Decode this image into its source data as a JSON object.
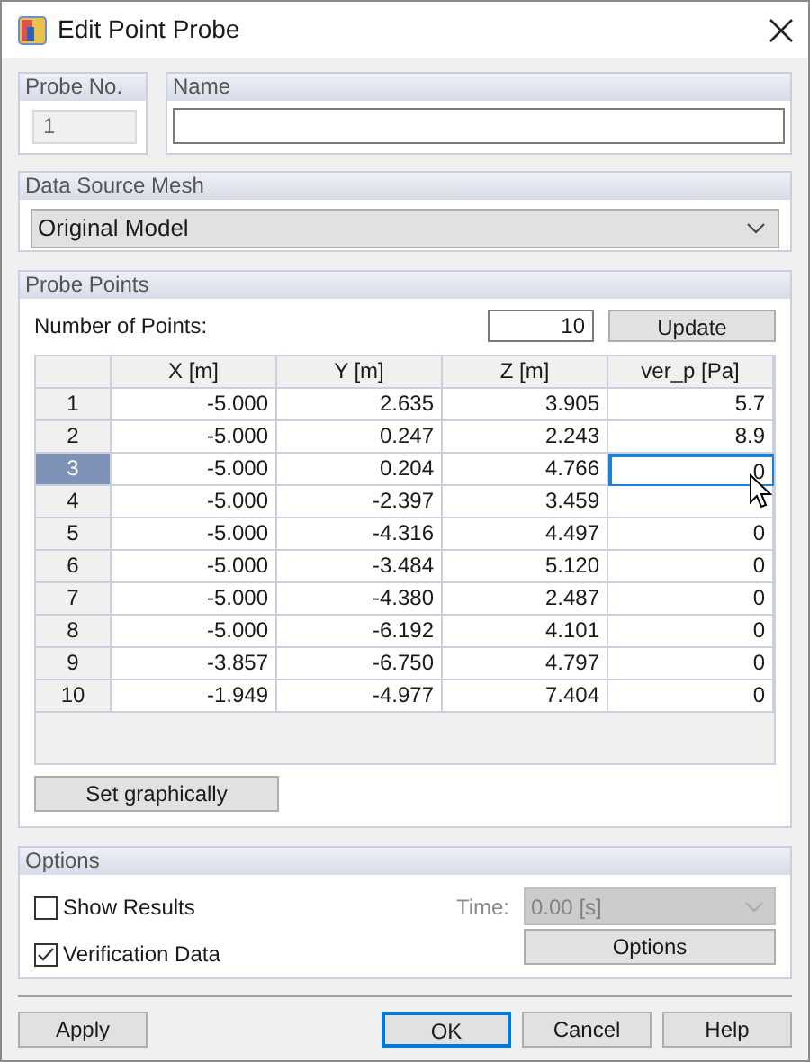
{
  "window": {
    "title": "Edit Point Probe"
  },
  "probe_no": {
    "label": "Probe No.",
    "value": "1",
    "disabled": true
  },
  "name": {
    "label": "Name"
  },
  "data_source_mesh": {
    "label": "Data Source Mesh",
    "value": "Original Model"
  },
  "probe_points": {
    "label": "Probe Points",
    "count_label": "Number of Points:",
    "count_value": "10",
    "update_button": "Update",
    "columns": [
      "X [m]",
      "Y [m]",
      "Z [m]",
      "ver_p [Pa]"
    ],
    "rows": [
      {
        "index": "1",
        "cells": [
          "-5.000",
          "2.635",
          "3.905",
          "5.7"
        ],
        "selected": false
      },
      {
        "index": "2",
        "cells": [
          "-5.000",
          "0.247",
          "2.243",
          "8.9"
        ],
        "selected": false
      },
      {
        "index": "3",
        "cells": [
          "-5.000",
          "0.204",
          "4.766",
          "0"
        ],
        "selected": true
      },
      {
        "index": "4",
        "cells": [
          "-5.000",
          "-2.397",
          "3.459"
        ],
        "selected": false
      },
      {
        "index": "5",
        "cells": [
          "-5.000",
          "-4.316",
          "4.497",
          "0"
        ],
        "selected": false
      },
      {
        "index": "6",
        "cells": [
          "-5.000",
          "-3.484",
          "5.120",
          "0"
        ],
        "selected": false
      },
      {
        "index": "7",
        "cells": [
          "-5.000",
          "-4.380",
          "2.487",
          "0"
        ],
        "selected": false
      },
      {
        "index": "8",
        "cells": [
          "-5.000",
          "-6.192",
          "4.101",
          "0"
        ],
        "selected": false
      },
      {
        "index": "9",
        "cells": [
          "-3.857",
          "-6.750",
          "4.797",
          "0"
        ],
        "selected": false
      },
      {
        "index": "10",
        "cells": [
          "-1.949",
          "-4.977",
          "7.404",
          "0"
        ],
        "selected": false
      }
    ],
    "set_graphically_button": "Set graphically"
  },
  "options": {
    "label": "Options",
    "checkboxes": [
      {
        "label": "Show Results",
        "checked": false
      },
      {
        "label": "Verification Data",
        "checked": true
      }
    ],
    "time": {
      "label": "Time:",
      "value": "0.00 [s]",
      "disabled": true
    },
    "options_button": "Options"
  },
  "buttons": [
    {
      "label": "Apply",
      "default": false
    },
    {
      "label": "OK",
      "default": true
    },
    {
      "label": "Cancel",
      "default": false
    },
    {
      "label": "Help",
      "default": false
    }
  ]
}
